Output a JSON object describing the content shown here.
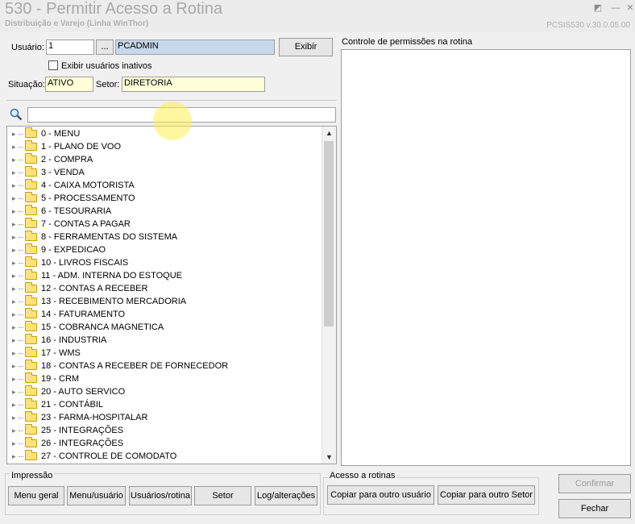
{
  "window": {
    "title": "530 - Permitir Acesso a Rotina",
    "subtitle": "Distribuição e Varejo (Linha WinThor)",
    "version": "PCSIS530 v.30.0.05.00"
  },
  "user": {
    "label": "Usuário:",
    "code": "1",
    "lookup_label": "...",
    "name": "PCADMIN",
    "show_button": "Exibir",
    "inactive_checkbox_label": "Exibir usuários inativos"
  },
  "status": {
    "situacao_label": "Situação:",
    "situacao_value": "ATIVO",
    "setor_label": "Setor:",
    "setor_value": "DIRETORIA"
  },
  "search": {
    "value": "",
    "icon": "search-icon"
  },
  "tree": {
    "items": [
      "0 - MENU",
      "1 - PLANO DE VOO",
      "2 - COMPRA",
      "3 - VENDA",
      "4 - CAIXA MOTORISTA",
      "5 - PROCESSAMENTO",
      "6 - TESOURARIA",
      "7 - CONTAS A PAGAR",
      "8 - FERRAMENTAS DO SISTEMA",
      "9 - EXPEDICAO",
      "10 - LIVROS FISCAIS",
      "11 - ADM. INTERNA DO ESTOQUE",
      "12 - CONTAS A RECEBER",
      "13 - RECEBIMENTO MERCADORIA",
      "14 - FATURAMENTO",
      "15 - COBRANCA MAGNETICA",
      "16 - INDUSTRIA",
      "17 - WMS",
      "18 - CONTAS A RECEBER DE FORNECEDOR",
      "19 - CRM",
      "20 - AUTO SERVICO",
      "21 - CONTÁBIL",
      "23 - FARMA-HOSPITALAR",
      "25 - INTEGRAÇÕES",
      "26 - INTEGRAÇÕES",
      "27 - CONTROLE DE COMODATO"
    ]
  },
  "permissions_panel": {
    "title": "Controle de permissões na rotina"
  },
  "impressao": {
    "title": "Impressão",
    "buttons": [
      "Menu geral",
      "Menu/usuário",
      "Usuários/rotina",
      "Setor",
      "Log/alterações"
    ]
  },
  "acesso": {
    "title": "Acesso a rotinas",
    "buttons": [
      "Copiar para outro usuário",
      "Copiar para outro Setor"
    ]
  },
  "actions": {
    "confirm": "Confirmar",
    "close": "Fechar"
  }
}
